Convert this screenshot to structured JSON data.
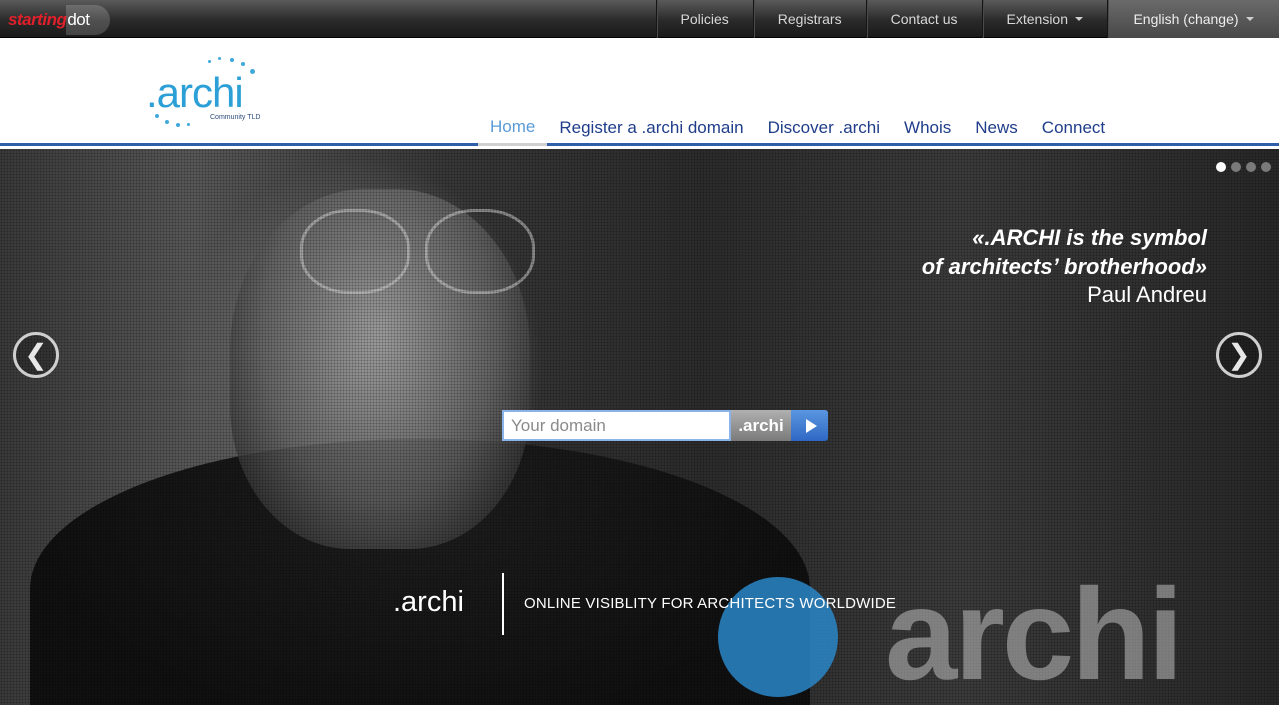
{
  "topbar": {
    "brand_part1": "starting",
    "brand_part2": "dot",
    "nav": [
      {
        "label": "Policies"
      },
      {
        "label": "Registrars"
      },
      {
        "label": "Contact us"
      },
      {
        "label": "Extension"
      }
    ],
    "language": "English (change)"
  },
  "logo": {
    "word": ".archi",
    "tagline": "Community TLD"
  },
  "main_nav": [
    {
      "label": "Home",
      "active": true
    },
    {
      "label": "Register a .archi domain"
    },
    {
      "label": "Discover .archi"
    },
    {
      "label": "Whois"
    },
    {
      "label": "News"
    },
    {
      "label": "Connect"
    }
  ],
  "hero": {
    "quote_line1": "«.ARCHI is the symbol",
    "quote_line2": "of architects’ brotherhood»",
    "quote_author": "Paul Andreu",
    "prev_arrow": "❮",
    "next_arrow": "❯",
    "search_placeholder": "Your domain",
    "tld": ".archi",
    "brand": ".archi",
    "slogan": "ONLINE VISIBLITY FOR ARCHITECTS WORLDWIDE",
    "background_word": "archi",
    "slides_total": 4,
    "slide_active": 1
  },
  "colors": {
    "accent_blue": "#1f3d8a",
    "logo_blue": "#2ca0d6",
    "header_rule": "#2f5fa8"
  }
}
